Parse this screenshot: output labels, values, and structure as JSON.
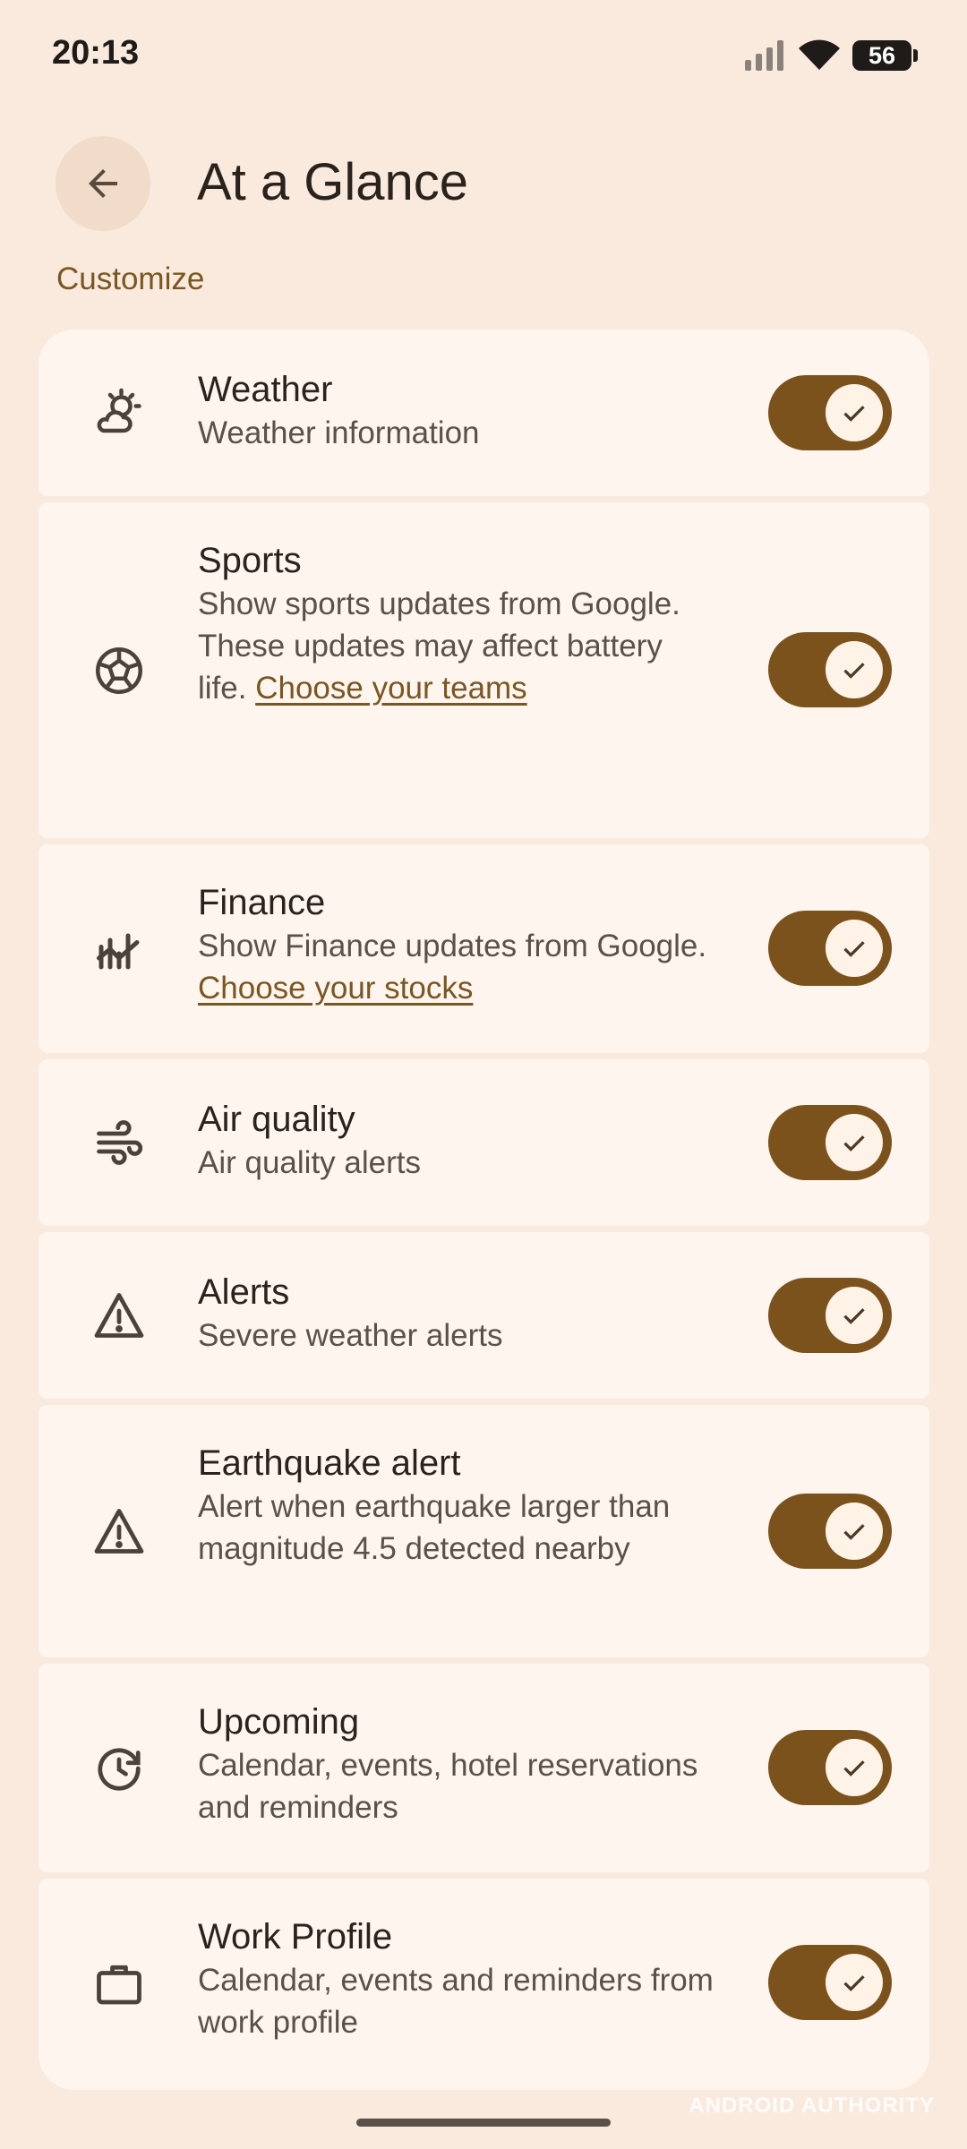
{
  "status_bar": {
    "time": "20:13",
    "battery": "56"
  },
  "header": {
    "title": "At a Glance",
    "back_icon": "arrow-back-icon"
  },
  "section": {
    "label": "Customize"
  },
  "items": [
    {
      "title": "Weather",
      "desc": "Weather information",
      "icon": "weather-icon",
      "enabled": true
    },
    {
      "title": "Sports",
      "desc": "Show sports updates from Google.\nThese updates may affect battery life. ",
      "link": "Choose your teams",
      "icon": "soccer-ball-icon",
      "enabled": true
    },
    {
      "title": "Finance",
      "desc": "Show Finance updates from Google. ",
      "link": "Choose your stocks",
      "icon": "finance-chart-icon",
      "enabled": true
    },
    {
      "title": "Air quality",
      "desc": "Air quality alerts",
      "icon": "air-icon",
      "enabled": true
    },
    {
      "title": "Alerts",
      "desc": "Severe weather alerts",
      "icon": "warning-icon",
      "enabled": true
    },
    {
      "title": "Earthquake alert",
      "desc": "Alert when earthquake larger than magnitude 4.5 detected nearby",
      "icon": "warning-icon",
      "enabled": true
    },
    {
      "title": "Upcoming",
      "desc": "Calendar, events, hotel reservations and reminders",
      "icon": "upcoming-clock-icon",
      "enabled": true
    },
    {
      "title": "Work Profile",
      "desc": "Calendar, events and reminders from work profile",
      "icon": "briefcase-icon",
      "enabled": true
    }
  ],
  "watermark": "ANDROID AUTHORITY",
  "colors": {
    "background": "#f9eadd",
    "card": "#fef5ef",
    "accent": "#7b521c",
    "link": "#7a5620"
  }
}
